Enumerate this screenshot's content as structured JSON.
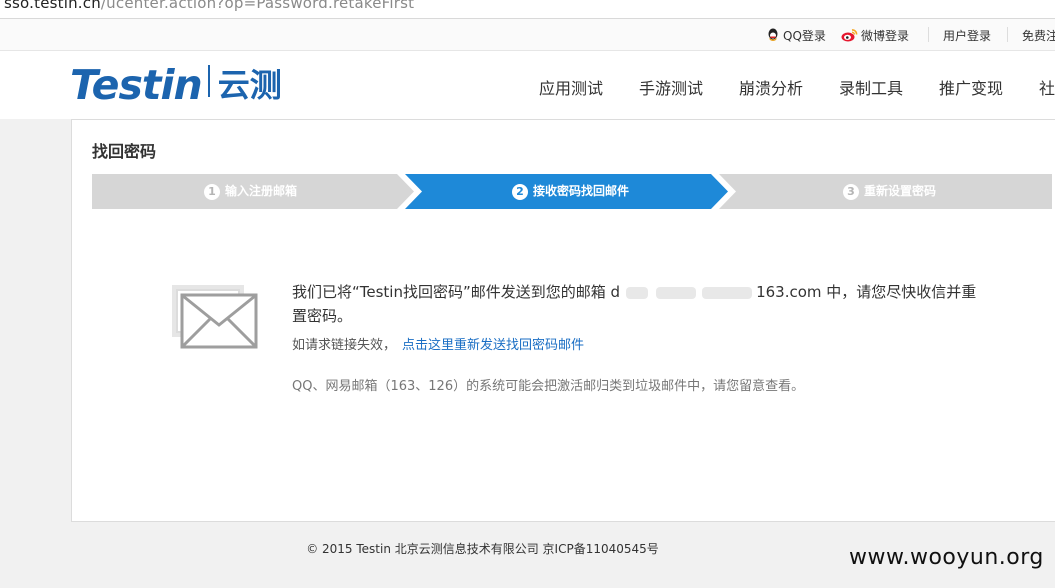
{
  "browser": {
    "url_host": "sso.testin.cn",
    "url_path": "/ucenter.action?op=Password.retakeFirst"
  },
  "toolbar": {
    "qq_login": "QQ登录",
    "weibo_login": "微博登录",
    "user_login": "用户登录",
    "free_register": "免费注"
  },
  "header": {
    "logo_en": "Testin",
    "logo_cn": "云测",
    "nav": [
      "应用测试",
      "手游测试",
      "崩溃分析",
      "录制工具",
      "推广变现",
      "社"
    ]
  },
  "card": {
    "title": "找回密码",
    "steps": [
      {
        "num": "1",
        "label": "输入注册邮箱",
        "state": "done"
      },
      {
        "num": "2",
        "label": "接收密码找回邮件",
        "state": "active"
      },
      {
        "num": "3",
        "label": "重新设置密码",
        "state": "pending"
      }
    ],
    "message_prefix": "我们已将“Testin找回密码”邮件发送到您的邮箱 ",
    "email_visible_start": "d",
    "email_visible_end": "163.com",
    "message_suffix": " 中，请您尽快收信并重置密码。",
    "resend_prompt": "如请求链接失效，",
    "resend_link": "点击这里重新发送找回密码邮件",
    "note": "QQ、网易邮箱（163、126）的系统可能会把激活邮归类到垃圾邮件中，请您留意查看。"
  },
  "footer": {
    "copyright": "© 2015 Testin 北京云测信息技术有限公司 京ICP备11040545号"
  },
  "watermark": "www.wooyun.org",
  "colors": {
    "brand": "#1c64ae",
    "step_active": "#1e89d8",
    "step_inactive": "#d6d6d6",
    "link": "#1a6ec4"
  }
}
